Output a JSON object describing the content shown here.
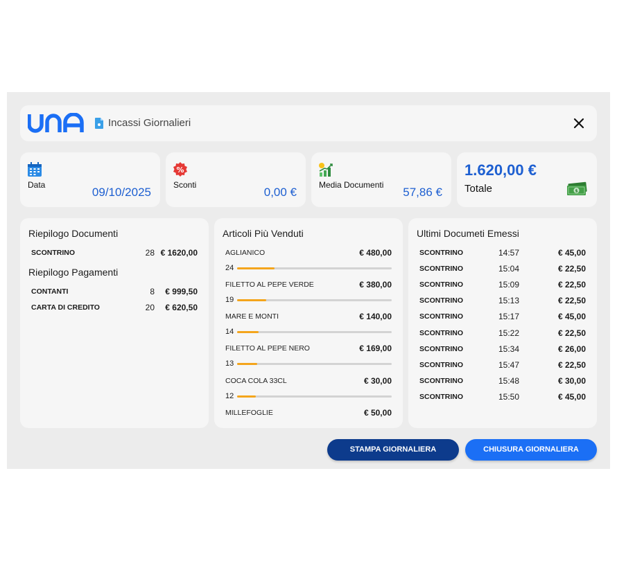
{
  "header": {
    "logo_text": "UNA",
    "title": "Incassi Giornalieri"
  },
  "stats": {
    "date": {
      "label": "Data",
      "value": "09/10/2025"
    },
    "discounts": {
      "label": "Sconti",
      "value": "0,00 €"
    },
    "average": {
      "label": "Media Documenti",
      "value": "57,86 €"
    },
    "total": {
      "label": "Totale",
      "value": "1.620,00 €"
    }
  },
  "summary": {
    "documents_title": "Riepilogo Documenti",
    "documents": [
      {
        "type": "SCONTRINO",
        "count": "28",
        "amount": "€ 1620,00"
      }
    ],
    "payments_title": "Riepilogo Pagamenti",
    "payments": [
      {
        "type": "CONTANTI",
        "count": "8",
        "amount": "€ 999,50"
      },
      {
        "type": "CARTA DI CREDITO",
        "count": "20",
        "amount": "€ 620,50"
      }
    ]
  },
  "top_items": {
    "title": "Articoli Più Venduti",
    "items": [
      {
        "name": "AGLIANICO",
        "price": "€ 480,00",
        "qty": "24"
      },
      {
        "name": "FILETTO AL PEPE VERDE",
        "price": "€ 380,00",
        "qty": "19"
      },
      {
        "name": "MARE E MONTI",
        "price": "€ 140,00",
        "qty": "14"
      },
      {
        "name": "FILETTO AL PEPE NERO",
        "price": "€ 169,00",
        "qty": "13"
      },
      {
        "name": "COCA COLA 33CL",
        "price": "€ 30,00",
        "qty": "12"
      },
      {
        "name": "MILLEFOGLIE",
        "price": "€ 50,00"
      }
    ],
    "bar_fractions": [
      0.24,
      0.19,
      0.14,
      0.13,
      0.12
    ]
  },
  "recent_docs": {
    "title": "Ultimi Documeti Emessi",
    "rows": [
      {
        "type": "SCONTRINO",
        "time": "14:57",
        "amount": "€ 45,00"
      },
      {
        "type": "SCONTRINO",
        "time": "15:04",
        "amount": "€ 22,50"
      },
      {
        "type": "SCONTRINO",
        "time": "15:09",
        "amount": "€ 22,50"
      },
      {
        "type": "SCONTRINO",
        "time": "15:13",
        "amount": "€ 22,50"
      },
      {
        "type": "SCONTRINO",
        "time": "15:17",
        "amount": "€ 45,00"
      },
      {
        "type": "SCONTRINO",
        "time": "15:22",
        "amount": "€ 22,50"
      },
      {
        "type": "SCONTRINO",
        "time": "15:34",
        "amount": "€ 26,00"
      },
      {
        "type": "SCONTRINO",
        "time": "15:47",
        "amount": "€ 22,50"
      },
      {
        "type": "SCONTRINO",
        "time": "15:48",
        "amount": "€ 30,00"
      },
      {
        "type": "SCONTRINO",
        "time": "15:50",
        "amount": "€ 45,00"
      }
    ]
  },
  "actions": {
    "print_label": "STAMPA GIORNALIERA",
    "close_label": "CHIUSURA GIORNALIERA"
  },
  "colors": {
    "brand_blue": "#1b6ff5",
    "dark_blue": "#0d3b8c",
    "value_blue": "#1d5fd1",
    "bar_orange": "#f4a51c"
  },
  "icons": [
    "una-logo",
    "document-icon",
    "close-icon",
    "calendar-icon",
    "percent-icon",
    "chart-growth-icon",
    "money-icon"
  ]
}
